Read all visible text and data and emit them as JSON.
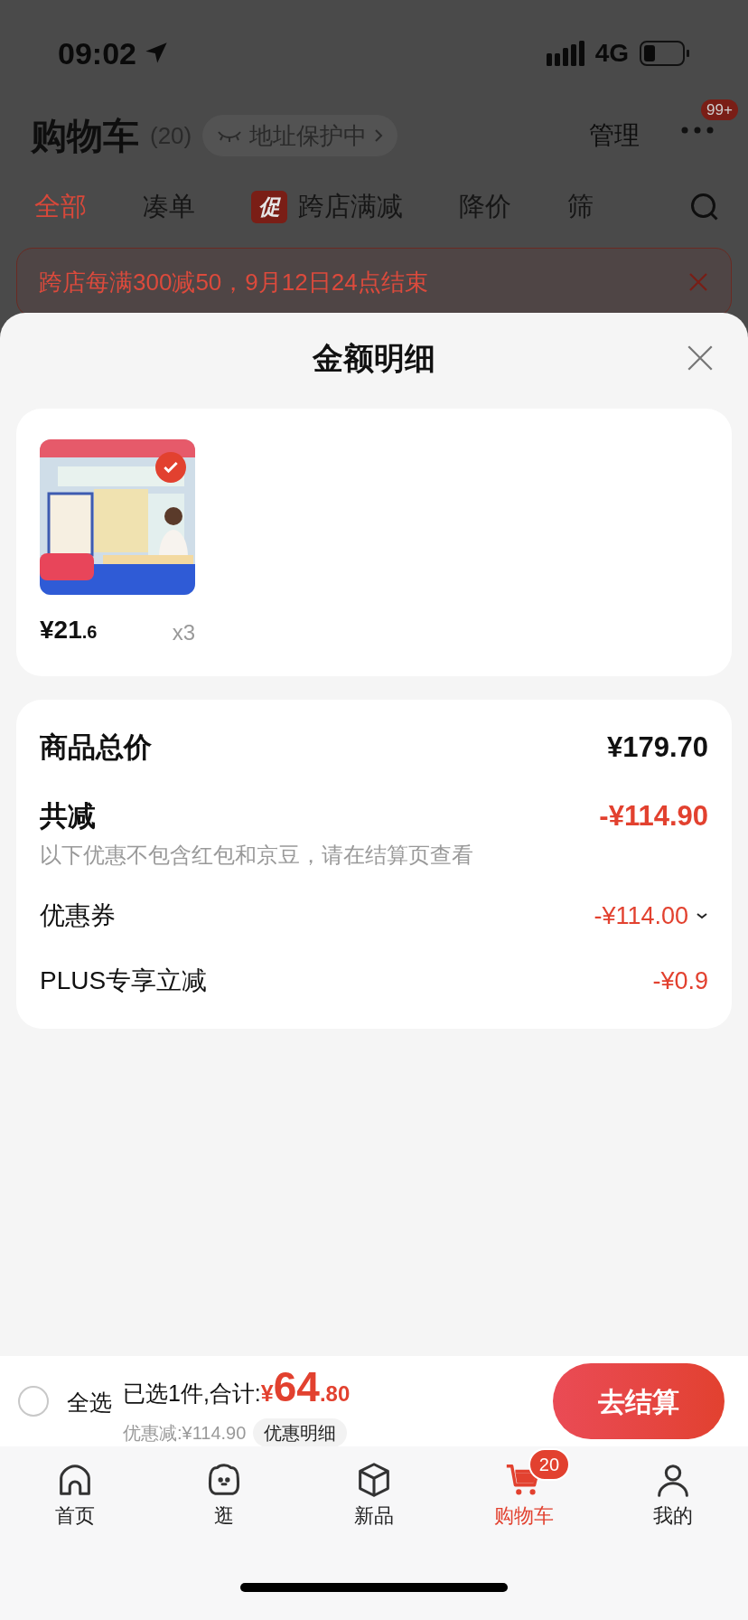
{
  "status_bar": {
    "time": "09:02",
    "network": "4G"
  },
  "header": {
    "title": "购物车",
    "count": "(20)",
    "address_chip": "地址保护中",
    "manage": "管理",
    "more_badge": "99+"
  },
  "tabs": [
    {
      "label": "全部",
      "selected": true
    },
    {
      "label": "凑单",
      "selected": false
    },
    {
      "label": "跨店满减",
      "selected": false,
      "tag": "促"
    },
    {
      "label": "降价",
      "selected": false
    },
    {
      "label": "筛",
      "selected": false
    }
  ],
  "promo_banner": {
    "text": "跨店每满300减50，9月12日24点结束"
  },
  "sheet": {
    "title": "金额明细",
    "products": [
      {
        "kind": "picture",
        "selected": true,
        "price_main": "¥21",
        "price_decimal": ".6",
        "quantity": "x3"
      }
    ],
    "summary": {
      "total_label": "商品总价",
      "total_value": "¥179.70",
      "discount_label": "共减",
      "discount_value": "-¥114.90",
      "note": "以下优惠不包含红包和京豆，请在结算页查看",
      "items": [
        {
          "label": "优惠券",
          "value": "-¥114.00",
          "expandable": true
        },
        {
          "label": "PLUS专享立减",
          "value": "-¥0.9",
          "expandable": false
        }
      ]
    }
  },
  "checkout_bar": {
    "select_all": {
      "label": "全选",
      "checked": false
    },
    "summary_prefix": "已选1件,合计:",
    "currency": "¥",
    "amount_main": "64",
    "amount_decimal": ".80",
    "discount_text": "优惠减:¥114.90",
    "detail_button": "优惠明细",
    "checkout_button": "去结算"
  },
  "tab_bar": [
    {
      "label": "首页",
      "selected": false,
      "kind": "home"
    },
    {
      "label": "逛",
      "selected": false,
      "kind": "face"
    },
    {
      "label": "新品",
      "selected": false,
      "kind": "box"
    },
    {
      "label": "购物车",
      "selected": true,
      "kind": "cart",
      "badge": "20"
    },
    {
      "label": "我的",
      "selected": false,
      "kind": "user"
    }
  ]
}
